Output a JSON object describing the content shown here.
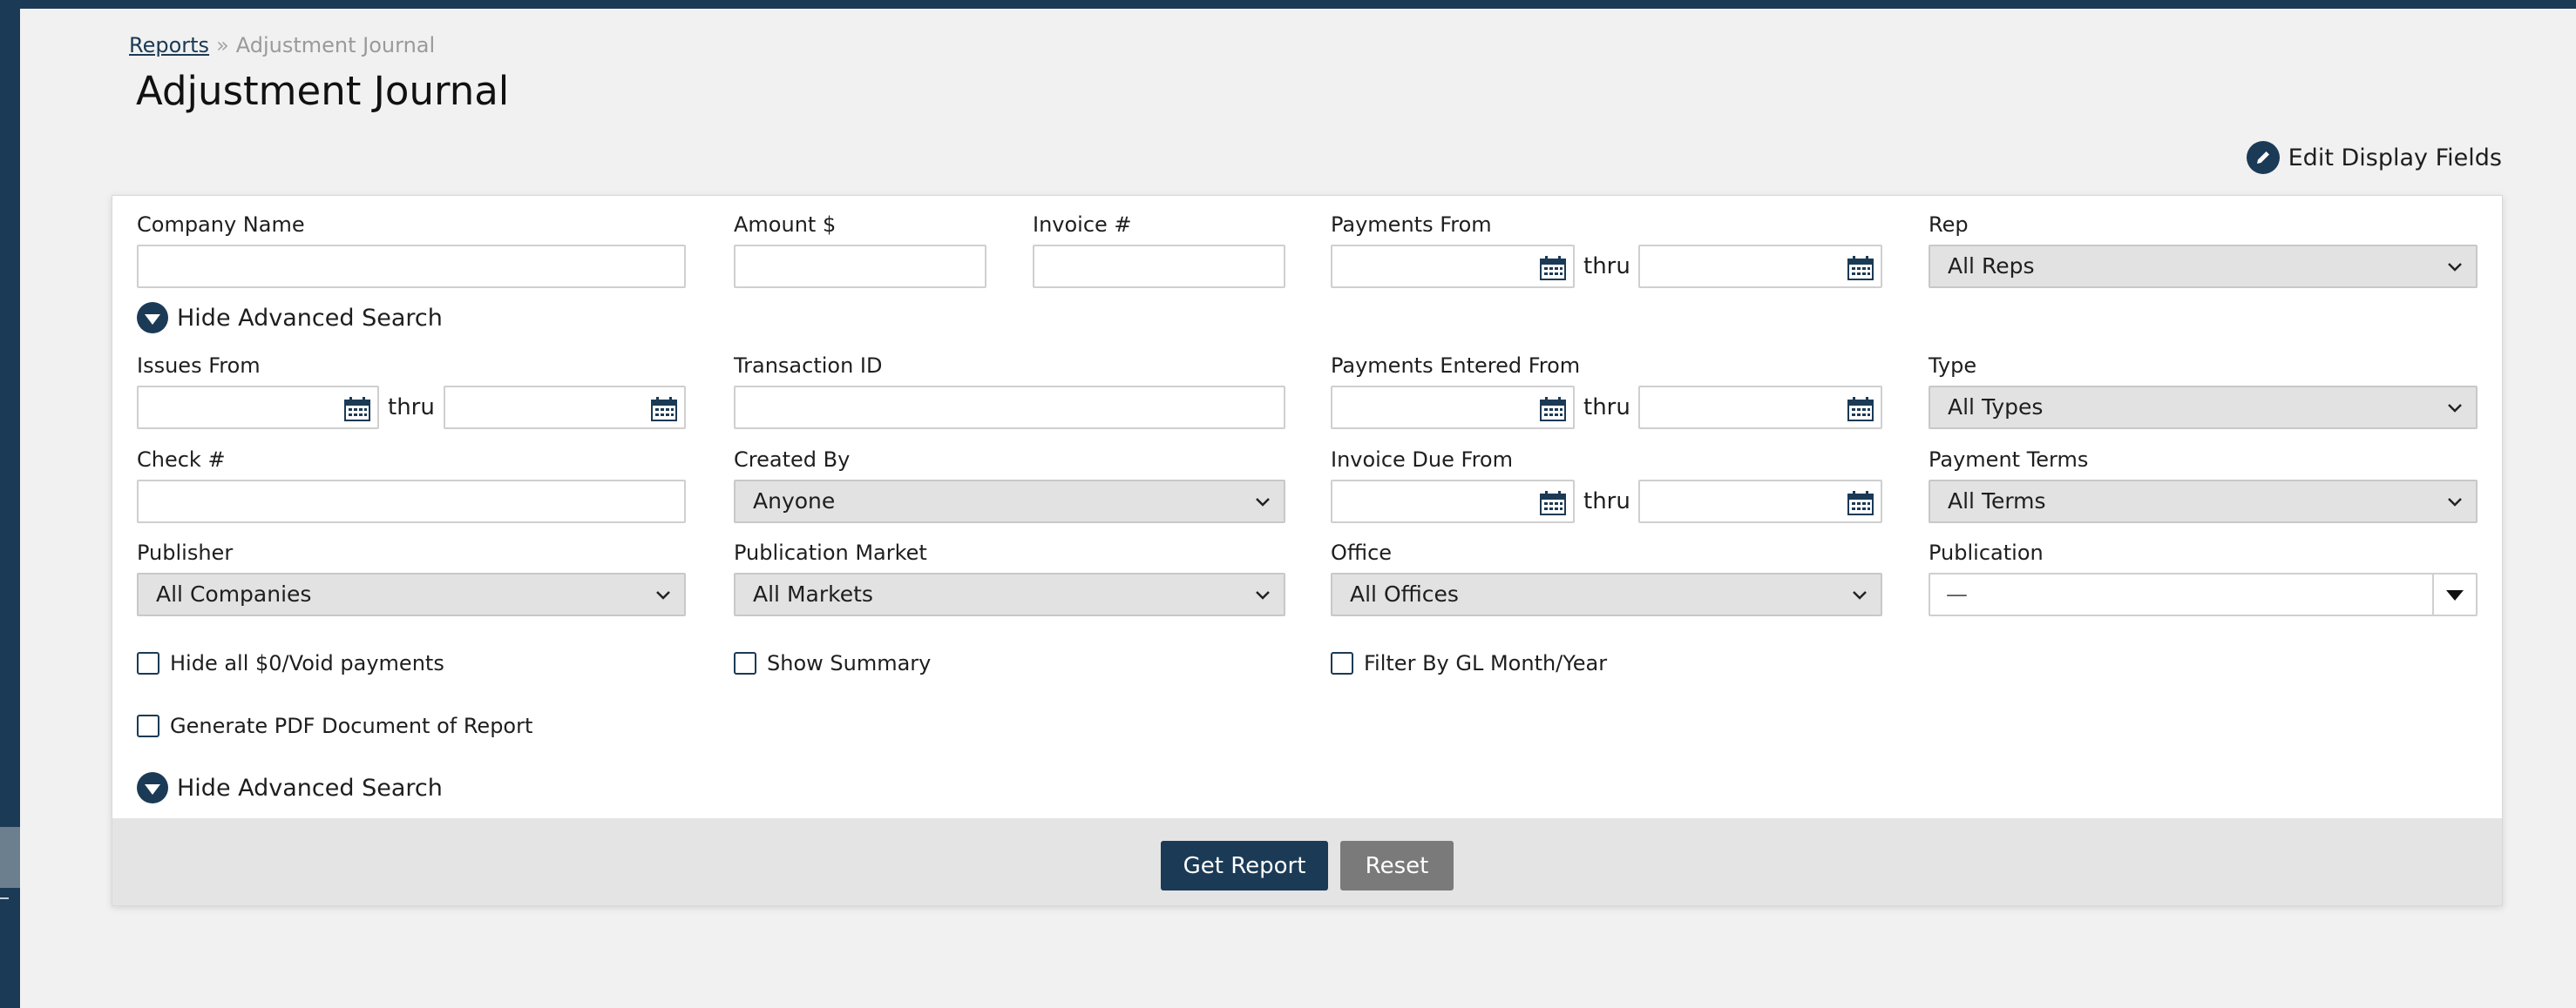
{
  "breadcrumb": {
    "link": "Reports",
    "separator": "»",
    "current": "Adjustment Journal"
  },
  "page_title": "Adjustment Journal",
  "edit_display_fields": "Edit Display Fields",
  "colors": {
    "navy": "#1b3a55",
    "panel_footer": "#e4e4e4",
    "reset_button": "#7a7a7a"
  },
  "form": {
    "company_name": {
      "label": "Company Name",
      "value": ""
    },
    "amount": {
      "label": "Amount $",
      "value": ""
    },
    "invoice_no": {
      "label": "Invoice #",
      "value": ""
    },
    "payments_from": {
      "label": "Payments From",
      "thru": "thru"
    },
    "rep": {
      "label": "Rep",
      "value": "All Reps"
    },
    "advanced_toggle": "Hide Advanced Search",
    "issues_from": {
      "label": "Issues From",
      "thru": "thru"
    },
    "transaction_id": {
      "label": "Transaction ID",
      "value": ""
    },
    "payments_entered_from": {
      "label": "Payments Entered From",
      "thru": "thru"
    },
    "type": {
      "label": "Type",
      "value": "All Types"
    },
    "check_no": {
      "label": "Check #",
      "value": ""
    },
    "created_by": {
      "label": "Created By",
      "value": "Anyone"
    },
    "invoice_due_from": {
      "label": "Invoice Due From",
      "thru": "thru"
    },
    "payment_terms": {
      "label": "Payment Terms",
      "value": "All Terms"
    },
    "publisher": {
      "label": "Publisher",
      "value": "All Companies"
    },
    "publication_market": {
      "label": "Publication Market",
      "value": "All Markets"
    },
    "office": {
      "label": "Office",
      "value": "All Offices"
    },
    "publication": {
      "label": "Publication",
      "value": "—"
    },
    "checkboxes": {
      "hide_zero_void": "Hide all $0/Void payments",
      "show_summary": "Show Summary",
      "filter_gl": "Filter By GL Month/Year",
      "generate_pdf": "Generate PDF Document of Report"
    }
  },
  "buttons": {
    "get_report": "Get Report",
    "reset": "Reset"
  }
}
